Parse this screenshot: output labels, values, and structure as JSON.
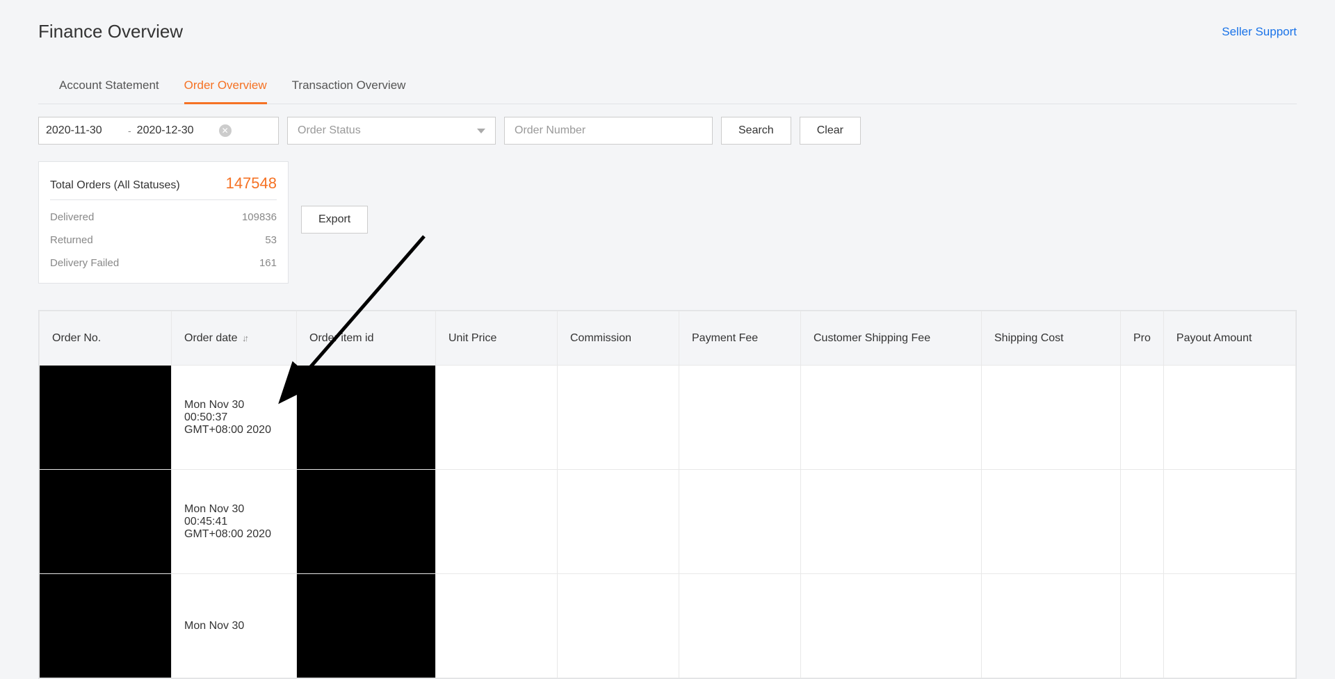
{
  "header": {
    "title": "Finance Overview",
    "support_link": "Seller Support"
  },
  "tabs": [
    {
      "label": "Account Statement",
      "active": false
    },
    {
      "label": "Order Overview",
      "active": true
    },
    {
      "label": "Transaction Overview",
      "active": false
    }
  ],
  "filters": {
    "date_from": "2020-11-30",
    "date_sep": "-",
    "date_to": "2020-12-30",
    "status_placeholder": "Order Status",
    "order_number_placeholder": "Order Number",
    "search_label": "Search",
    "clear_label": "Clear"
  },
  "summary": {
    "total_label": "Total Orders (All Statuses)",
    "total_value": "147548",
    "rows": [
      {
        "label": "Delivered",
        "value": "109836"
      },
      {
        "label": "Returned",
        "value": "53"
      },
      {
        "label": "Delivery Failed",
        "value": "161"
      }
    ],
    "export_label": "Export"
  },
  "table": {
    "columns": {
      "order_no": "Order No.",
      "order_date": "Order date",
      "order_item_id": "Order item id",
      "unit_price": "Unit Price",
      "commission": "Commission",
      "payment_fee": "Payment Fee",
      "customer_shipping_fee": "Customer Shipping Fee",
      "shipping_cost": "Shipping Cost",
      "pro": "Pro",
      "payout_amount": "Payout Amount"
    },
    "rows": [
      {
        "order_date": "Mon Nov 30 00:50:37 GMT+08:00 2020"
      },
      {
        "order_date": "Mon Nov 30 00:45:41 GMT+08:00 2020"
      },
      {
        "order_date": "Mon Nov 30"
      }
    ]
  }
}
